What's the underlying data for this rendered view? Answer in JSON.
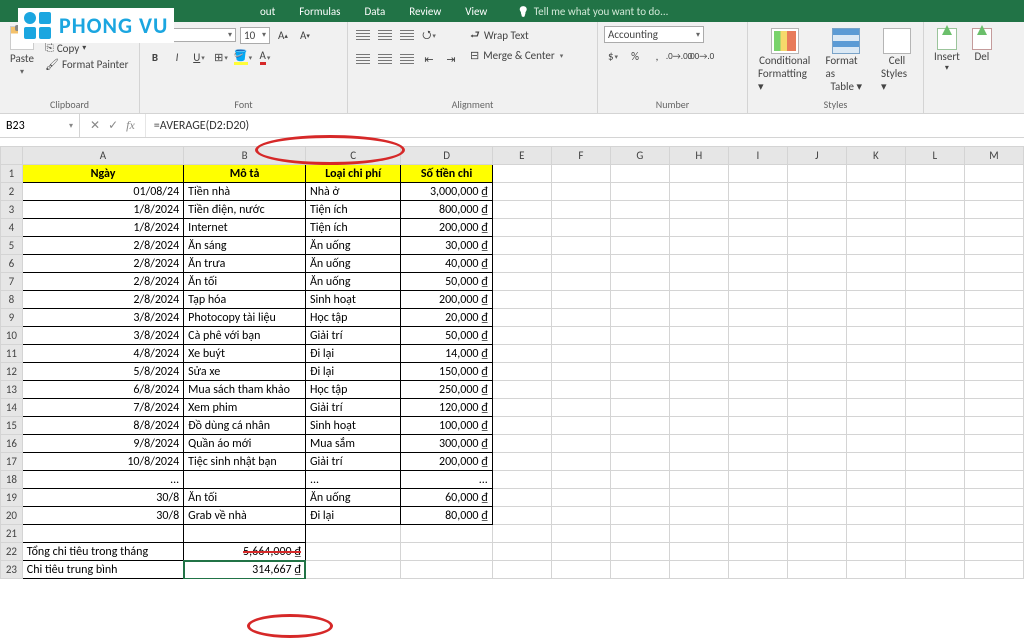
{
  "logo_text": "PHONG VU",
  "tabs": [
    "out",
    "Formulas",
    "Data",
    "Review",
    "View"
  ],
  "tellme": "Tell me what you want to do...",
  "clipboard": {
    "paste": "Paste",
    "copy": "Copy",
    "fpainter": "Format Painter",
    "label": "Clipboard"
  },
  "font": {
    "name": "",
    "size": "10",
    "label": "Font"
  },
  "alignment": {
    "wrap": "Wrap Text",
    "merge": "Merge & Center",
    "label": "Alignment"
  },
  "number": {
    "format": "Accounting",
    "label": "Number"
  },
  "styles": {
    "cf": "Conditional",
    "cf2": "Formatting",
    "fat": "Format as",
    "fat2": "Table",
    "cs": "Cell",
    "cs2": "Styles",
    "label": "Styles"
  },
  "cells": {
    "insert": "Insert",
    "delf": "Del"
  },
  "namebox": "B23",
  "formula": "=AVERAGE(D2:D20)",
  "colheads": [
    "A",
    "B",
    "C",
    "D",
    "E",
    "F",
    "G",
    "H",
    "I",
    "J",
    "K",
    "L",
    "M"
  ],
  "headers": {
    "A": "Ngày",
    "B": "Mô tả",
    "C": "Loại chi phí",
    "D": "Số tiền chi"
  },
  "rows": [
    {
      "n": "2",
      "A": "01/08/24",
      "B": "Tiền nhà",
      "C": "Nhà ở",
      "D": "3,000,000 ₫"
    },
    {
      "n": "3",
      "A": "1/8/2024",
      "B": "Tiền điện, nước",
      "C": "Tiện ích",
      "D": "800,000 ₫"
    },
    {
      "n": "4",
      "A": "1/8/2024",
      "B": "Internet",
      "C": "Tiện ích",
      "D": "200,000 ₫"
    },
    {
      "n": "5",
      "A": "2/8/2024",
      "B": "Ăn sáng",
      "C": "Ăn uống",
      "D": "30,000 ₫"
    },
    {
      "n": "6",
      "A": "2/8/2024",
      "B": "Ăn trưa",
      "C": "Ăn uống",
      "D": "40,000 ₫"
    },
    {
      "n": "7",
      "A": "2/8/2024",
      "B": "Ăn tối",
      "C": "Ăn uống",
      "D": "50,000 ₫"
    },
    {
      "n": "8",
      "A": "2/8/2024",
      "B": "Tạp hóa",
      "C": "Sinh hoạt",
      "D": "200,000 ₫"
    },
    {
      "n": "9",
      "A": "3/8/2024",
      "B": "Photocopy tài liệu",
      "C": "Học tập",
      "D": "20,000 ₫"
    },
    {
      "n": "10",
      "A": "3/8/2024",
      "B": "Cà phê với bạn",
      "C": "Giải trí",
      "D": "50,000 ₫"
    },
    {
      "n": "11",
      "A": "4/8/2024",
      "B": "Xe buýt",
      "C": "Đi lại",
      "D": "14,000 ₫"
    },
    {
      "n": "12",
      "A": "5/8/2024",
      "B": "Sửa xe",
      "C": "Đi lại",
      "D": "150,000 ₫"
    },
    {
      "n": "13",
      "A": "6/8/2024",
      "B": "Mua sách tham khảo",
      "C": "Học tập",
      "D": "250,000 ₫"
    },
    {
      "n": "14",
      "A": "7/8/2024",
      "B": "Xem phim",
      "C": "Giải trí",
      "D": "120,000 ₫"
    },
    {
      "n": "15",
      "A": "8/8/2024",
      "B": "Đồ dùng cá nhân",
      "C": "Sinh hoạt",
      "D": "100,000 ₫"
    },
    {
      "n": "16",
      "A": "9/8/2024",
      "B": "Quần áo mới",
      "C": "Mua sắm",
      "D": "300,000 ₫"
    },
    {
      "n": "17",
      "A": "10/8/2024",
      "B": "Tiệc sinh nhật bạn",
      "C": "Giải trí",
      "D": "200,000 ₫"
    },
    {
      "n": "18",
      "A": "...",
      "B": "",
      "C": "...",
      "D": "..."
    },
    {
      "n": "19",
      "A": "30/8",
      "B": "Ăn tối",
      "C": "Ăn uống",
      "D": "60,000 ₫"
    },
    {
      "n": "20",
      "A": "30/8",
      "B": "Grab về nhà",
      "C": "Đi lại",
      "D": "80,000 ₫"
    }
  ],
  "row21": {
    "n": "21"
  },
  "row22": {
    "n": "22",
    "A": "Tổng chi tiêu trong tháng",
    "B": "5,664,000 ₫"
  },
  "row23": {
    "n": "23",
    "A": "Chi tiêu trung bình",
    "B": "314,667 ₫"
  }
}
